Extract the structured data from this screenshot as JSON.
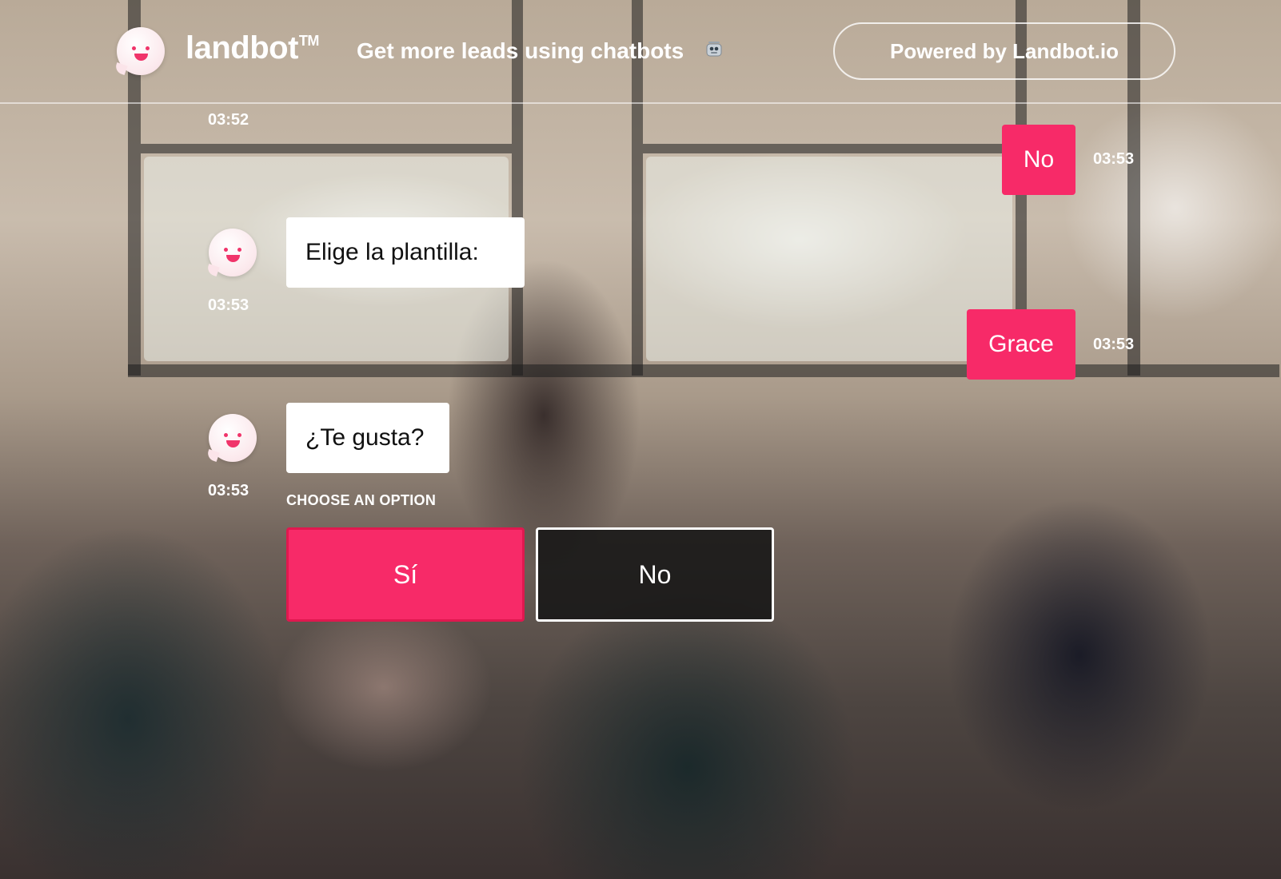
{
  "header": {
    "brand": "landbot",
    "trademark": "TM",
    "tagline": "Get more leads using chatbots",
    "tagline_icon": "robot-emoji-icon",
    "powered_by": "Powered by Landbot.io"
  },
  "colors": {
    "accent": "#f72a68",
    "bot_bubble": "#ffffff",
    "text_dark": "#111111"
  },
  "messages": [
    {
      "sender": "bot",
      "time": "03:52"
    },
    {
      "sender": "user",
      "text": "No",
      "time": "03:53"
    },
    {
      "sender": "bot",
      "text": "Elige la plantilla:",
      "time": "03:53"
    },
    {
      "sender": "user",
      "text": "Grace",
      "time": "03:53"
    },
    {
      "sender": "bot",
      "text": "¿Te gusta?",
      "time": "03:53"
    }
  ],
  "choices": {
    "label": "CHOOSE AN OPTION",
    "options": [
      {
        "label": "Sí",
        "selected": true
      },
      {
        "label": "No",
        "selected": false
      }
    ]
  }
}
